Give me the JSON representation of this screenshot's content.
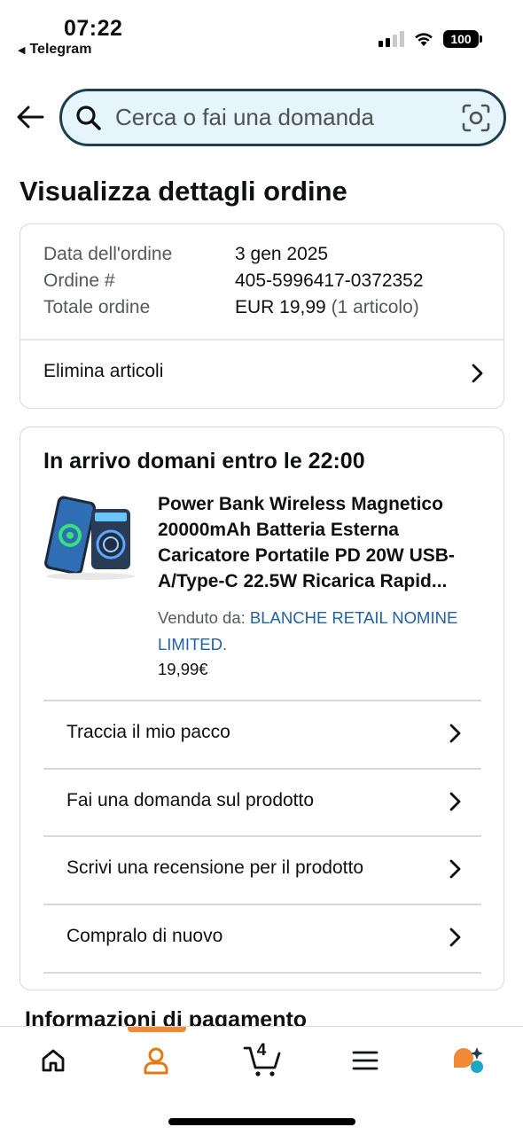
{
  "status_bar": {
    "time": "07:22",
    "back_app": "Telegram",
    "battery": "100"
  },
  "search": {
    "placeholder": "Cerca o fai una domanda"
  },
  "page": {
    "title": "Visualizza dettagli ordine"
  },
  "order_summary": {
    "date_label": "Data dell'ordine",
    "date_value": "3 gen 2025",
    "number_label": "Ordine #",
    "number_value": "405-5996417-0372352",
    "total_label": "Totale ordine",
    "total_value": "EUR 19,99",
    "total_items": "(1 articolo)",
    "delete_items": "Elimina articoli"
  },
  "shipment": {
    "status": "In arrivo domani entro le 22:00",
    "product_title": "Power Bank Wireless Magnetico 20000mAh Batteria Esterna Caricatore Portatile PD 20W USB-A/Type-C 22.5W Ricarica Rapid...",
    "sold_by_label": "Venduto da:",
    "seller": "BLANCHE RETAIL NOMINE LIMITED.",
    "price": "19,99€",
    "actions": [
      {
        "label": "Traccia il mio pacco"
      },
      {
        "label": "Fai una domanda sul prodotto"
      },
      {
        "label": "Scrivi una recensione per il prodotto"
      },
      {
        "label": "Compralo di nuovo"
      }
    ]
  },
  "payment": {
    "title": "Informazioni di pagamento"
  },
  "bottom_nav": {
    "cart_count": "4",
    "icons": [
      "home-icon",
      "account-icon",
      "cart-icon",
      "menu-icon",
      "rufus-icon"
    ]
  },
  "colors": {
    "search_bg": "#e6f4fb",
    "search_border": "#1f3e52",
    "link": "#2162a1",
    "accent": "#f08a36",
    "rufus_teal": "#1fa6c0"
  }
}
